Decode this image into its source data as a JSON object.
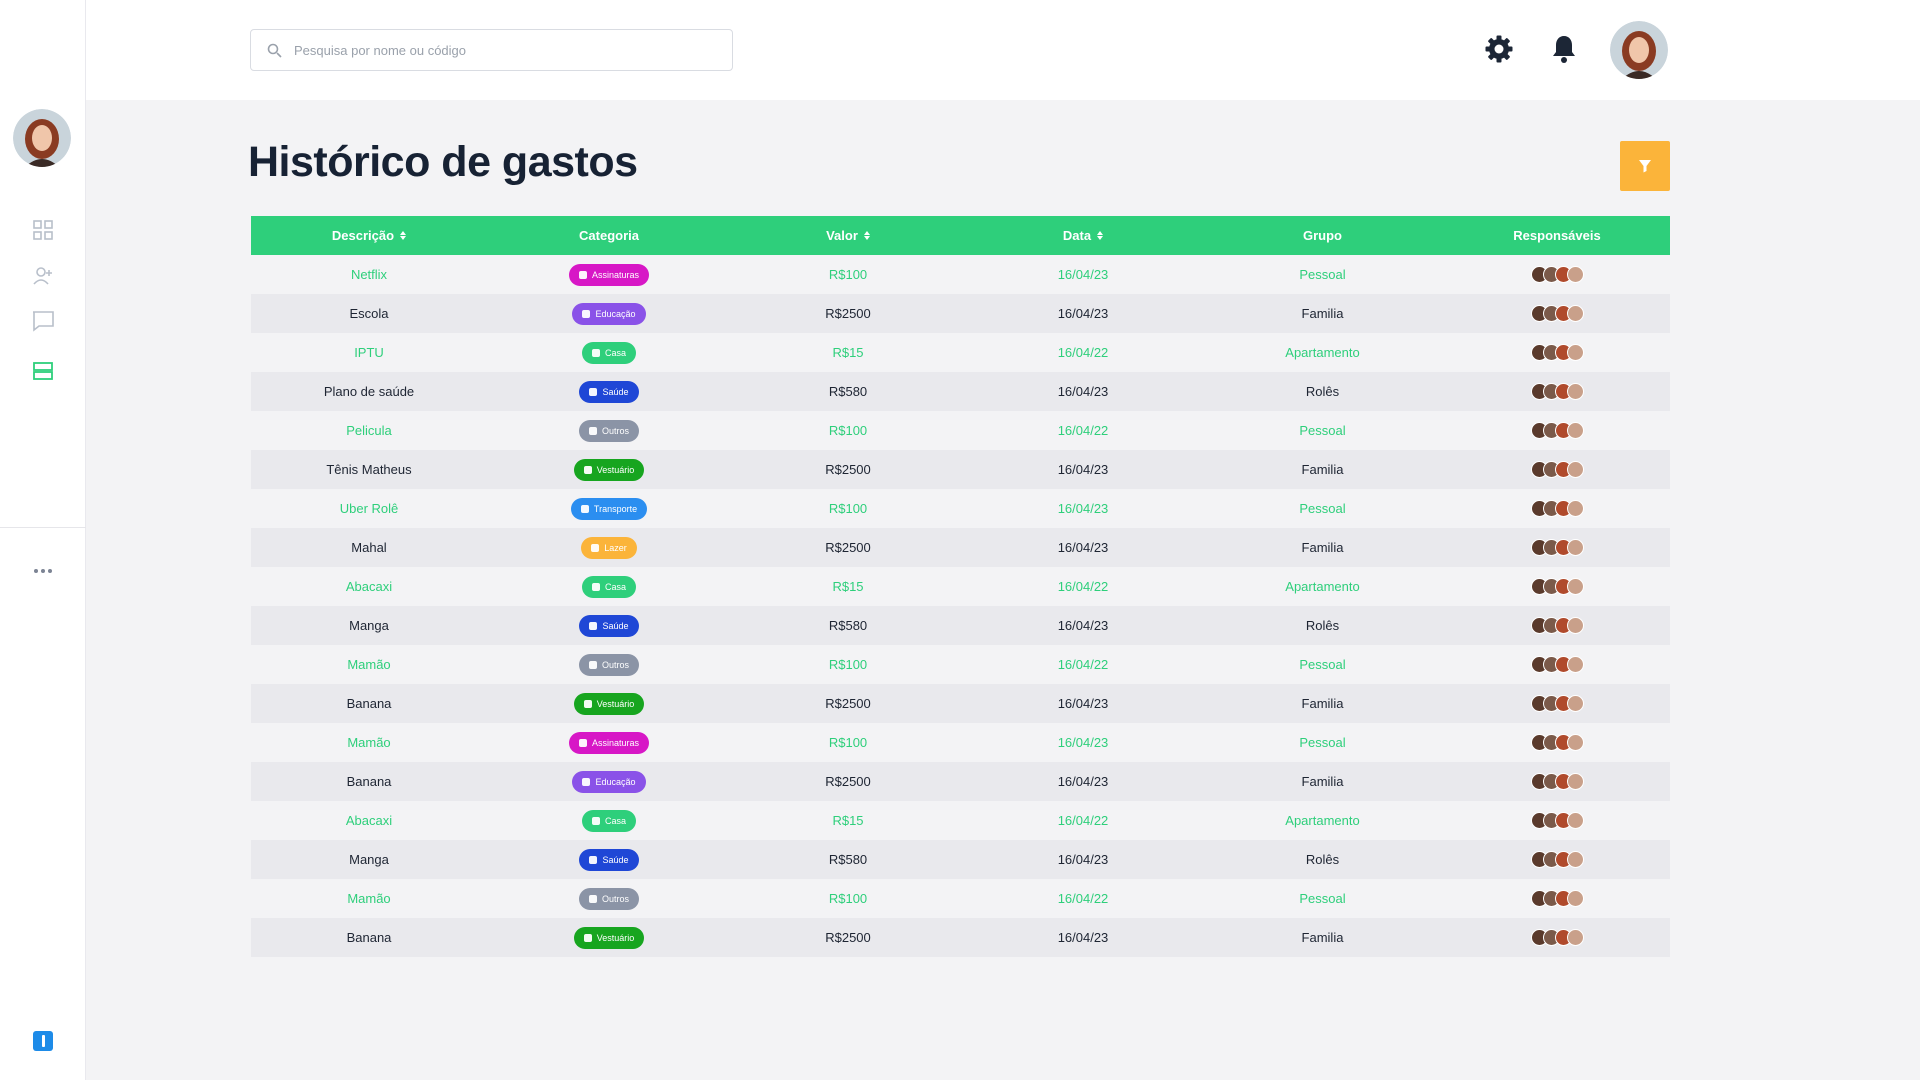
{
  "search": {
    "placeholder": "Pesquisa por nome ou código"
  },
  "page": {
    "title": "Histórico de gastos"
  },
  "colors": {
    "accent": "#2ecf7b",
    "filter": "#fbb43a",
    "odd_row_text": "#2ecf7b"
  },
  "table": {
    "headers": [
      "Descrição",
      "Categoria",
      "Valor",
      "Data",
      "Grupo",
      "Responsáveis"
    ],
    "rows": [
      {
        "descricao": "Netflix",
        "categoria": "Assinaturas",
        "cor": "#d717c6",
        "valor": "R$100",
        "data": "16/04/23",
        "grupo": "Pessoal"
      },
      {
        "descricao": "Escola",
        "categoria": "Educação",
        "cor": "#8a52e8",
        "valor": "R$2500",
        "data": "16/04/23",
        "grupo": "Familia"
      },
      {
        "descricao": "IPTU",
        "categoria": "Casa",
        "cor": "#2ecf7b",
        "valor": "R$15",
        "data": "16/04/22",
        "grupo": "Apartamento"
      },
      {
        "descricao": "Plano de saúde",
        "categoria": "Saúde",
        "cor": "#1f47d6",
        "valor": "R$580",
        "data": "16/04/23",
        "grupo": "Rolês"
      },
      {
        "descricao": "Pelicula",
        "categoria": "Outros",
        "cor": "#8b94a6",
        "valor": "R$100",
        "data": "16/04/22",
        "grupo": "Pessoal"
      },
      {
        "descricao": "Tênis Matheus",
        "categoria": "Vestuário",
        "cor": "#17a51f",
        "valor": "R$2500",
        "data": "16/04/23",
        "grupo": "Familia"
      },
      {
        "descricao": "Uber Rolê",
        "categoria": "Transporte",
        "cor": "#2b8ef0",
        "valor": "R$100",
        "data": "16/04/23",
        "grupo": "Pessoal"
      },
      {
        "descricao": "Mahal",
        "categoria": "Lazer",
        "cor": "#fbb43a",
        "valor": "R$2500",
        "data": "16/04/23",
        "grupo": "Familia"
      },
      {
        "descricao": "Abacaxi",
        "categoria": "Casa",
        "cor": "#2ecf7b",
        "valor": "R$15",
        "data": "16/04/22",
        "grupo": "Apartamento"
      },
      {
        "descricao": "Manga",
        "categoria": "Saúde",
        "cor": "#1f47d6",
        "valor": "R$580",
        "data": "16/04/23",
        "grupo": "Rolês"
      },
      {
        "descricao": "Mamão",
        "categoria": "Outros",
        "cor": "#8b94a6",
        "valor": "R$100",
        "data": "16/04/22",
        "grupo": "Pessoal"
      },
      {
        "descricao": "Banana",
        "categoria": "Vestuário",
        "cor": "#17a51f",
        "valor": "R$2500",
        "data": "16/04/23",
        "grupo": "Familia"
      },
      {
        "descricao": "Mamão",
        "categoria": "Assinaturas",
        "cor": "#d717c6",
        "valor": "R$100",
        "data": "16/04/23",
        "grupo": "Pessoal"
      },
      {
        "descricao": "Banana",
        "categoria": "Educação",
        "cor": "#8a52e8",
        "valor": "R$2500",
        "data": "16/04/23",
        "grupo": "Familia"
      },
      {
        "descricao": "Abacaxi",
        "categoria": "Casa",
        "cor": "#2ecf7b",
        "valor": "R$15",
        "data": "16/04/22",
        "grupo": "Apartamento"
      },
      {
        "descricao": "Manga",
        "categoria": "Saúde",
        "cor": "#1f47d6",
        "valor": "R$580",
        "data": "16/04/23",
        "grupo": "Rolês"
      },
      {
        "descricao": "Mamão",
        "categoria": "Outros",
        "cor": "#8b94a6",
        "valor": "R$100",
        "data": "16/04/22",
        "grupo": "Pessoal"
      },
      {
        "descricao": "Banana",
        "categoria": "Vestuário",
        "cor": "#17a51f",
        "valor": "R$2500",
        "data": "16/04/23",
        "grupo": "Familia"
      }
    ],
    "avatar_colors": [
      "#5a3a2c",
      "#7b5a4a",
      "#b04a2c",
      "#c9a08a"
    ]
  },
  "icons": {
    "sidebar": [
      "dashboard-icon",
      "users-add-icon",
      "chat-icon",
      "list-icon"
    ],
    "top": [
      "settings-icon",
      "notification-bell-icon"
    ]
  }
}
